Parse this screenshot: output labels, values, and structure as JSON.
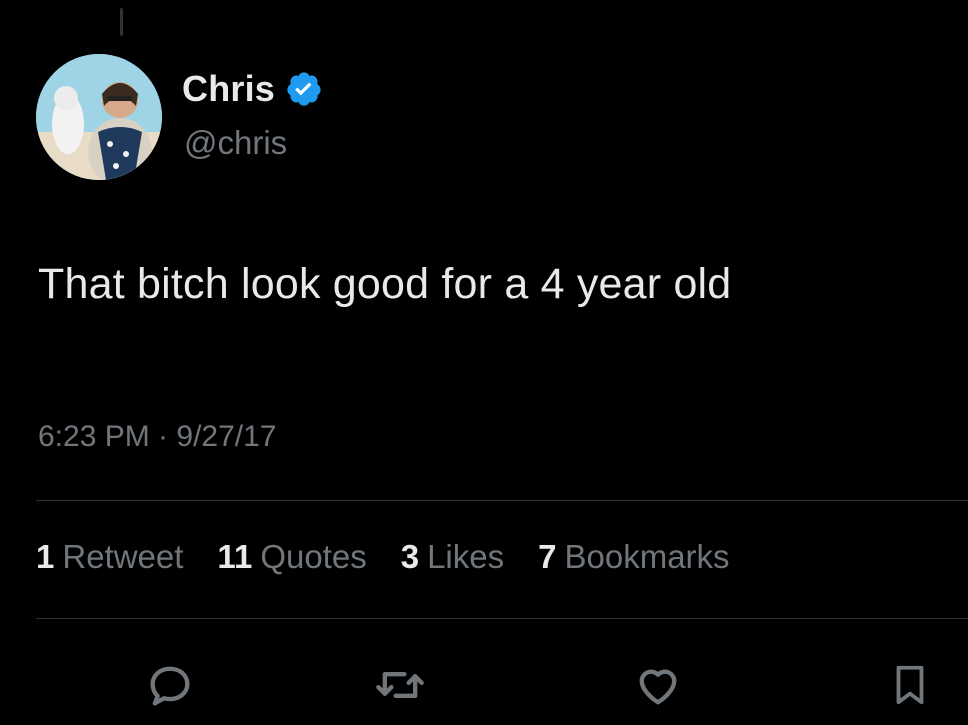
{
  "tweet": {
    "author": {
      "display_name": "Chris",
      "handle": "@chris",
      "verified": true
    },
    "text": "That bitch look good for a 4 year old",
    "timestamp": "6:23 PM · 9/27/17",
    "stats": [
      {
        "count": "1",
        "label": "Retweet"
      },
      {
        "count": "11",
        "label": "Quotes"
      },
      {
        "count": "3",
        "label": "Likes"
      },
      {
        "count": "7",
        "label": "Bookmarks"
      }
    ],
    "actions": [
      {
        "icon": "reply-icon"
      },
      {
        "icon": "retweet-icon"
      },
      {
        "icon": "like-icon"
      },
      {
        "icon": "bookmark-icon"
      }
    ]
  },
  "colors": {
    "background": "#000000",
    "primary_text": "#e7e9ea",
    "secondary_text": "#71767b",
    "divider": "#2f3336",
    "verified_badge": "#1d9bf0"
  }
}
